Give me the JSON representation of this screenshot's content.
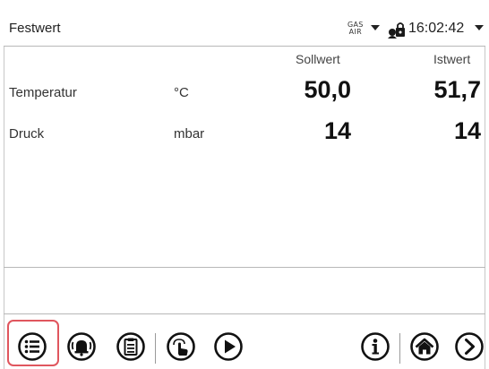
{
  "header": {
    "title": "Festwert",
    "gas_line1": "GAS",
    "gas_line2": "AIR",
    "time": "16:02:42"
  },
  "columns": {
    "setpoint": "Sollwert",
    "actual": "Istwert"
  },
  "rows": [
    {
      "label": "Temperatur",
      "unit": "°C",
      "setpoint": "50,0",
      "actual": "51,7"
    },
    {
      "label": "Druck",
      "unit": "mbar",
      "setpoint": "14",
      "actual": "14"
    }
  ],
  "toolbar": {
    "icons": [
      "menu-icon",
      "alarm-icon",
      "clipboard-icon",
      "touch-icon",
      "play-icon",
      "info-icon",
      "home-icon",
      "next-icon"
    ]
  },
  "colors": {
    "highlight": "#e0565e",
    "icon": "#111111"
  }
}
